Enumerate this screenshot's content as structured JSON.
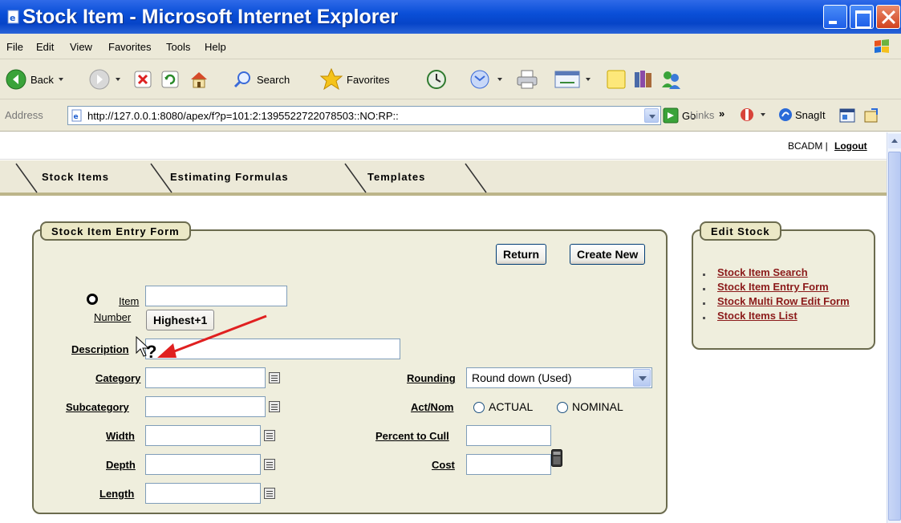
{
  "window": {
    "title": "Stock Item - Microsoft Internet Explorer"
  },
  "menu": [
    "File",
    "Edit",
    "View",
    "Favorites",
    "Tools",
    "Help"
  ],
  "toolbar": {
    "back": "Back",
    "search": "Search",
    "favorites": "Favorites"
  },
  "address": {
    "label": "Address",
    "url": "http://127.0.0.1:8080/apex/f?p=101:2:1395522722078503::NO:RP::",
    "go": "Go",
    "links": "Links",
    "links_chevron": "»",
    "snagit": "SnagIt"
  },
  "header": {
    "user": "BCADM |",
    "logout": "Logout"
  },
  "tabs": [
    "Stock Items",
    "Estimating Formulas",
    "Templates"
  ],
  "form": {
    "title": "Stock Item Entry Form",
    "return_button": "Return",
    "create_new_button": "Create New",
    "item_label_1": "Item",
    "item_label_2": "Number",
    "highest_button": "Highest+1",
    "help_mark": "?",
    "labels": {
      "description": "Description",
      "category": "Category",
      "subcategory": "Subcategory",
      "width": "Width",
      "depth": "Depth",
      "length": "Length",
      "rounding": "Rounding",
      "act_nom": "Act/Nom",
      "percent_to_cull": "Percent to Cull",
      "cost": "Cost"
    },
    "rounding_value": "Round down (Used)",
    "radio_actual": "ACTUAL",
    "radio_nominal": "NOMINAL"
  },
  "edit_stock": {
    "title": "Edit Stock",
    "links": [
      "Stock Item Search",
      "Stock Item Entry Form",
      "Stock Multi Row Edit Form",
      "Stock Items List"
    ]
  },
  "colors": {
    "titlebar": "#0a4fd8",
    "chrome": "#ece9d8",
    "region_bg": "#efeedd",
    "link": "#8b1a1a",
    "annotation_arrow": "#e02020"
  }
}
